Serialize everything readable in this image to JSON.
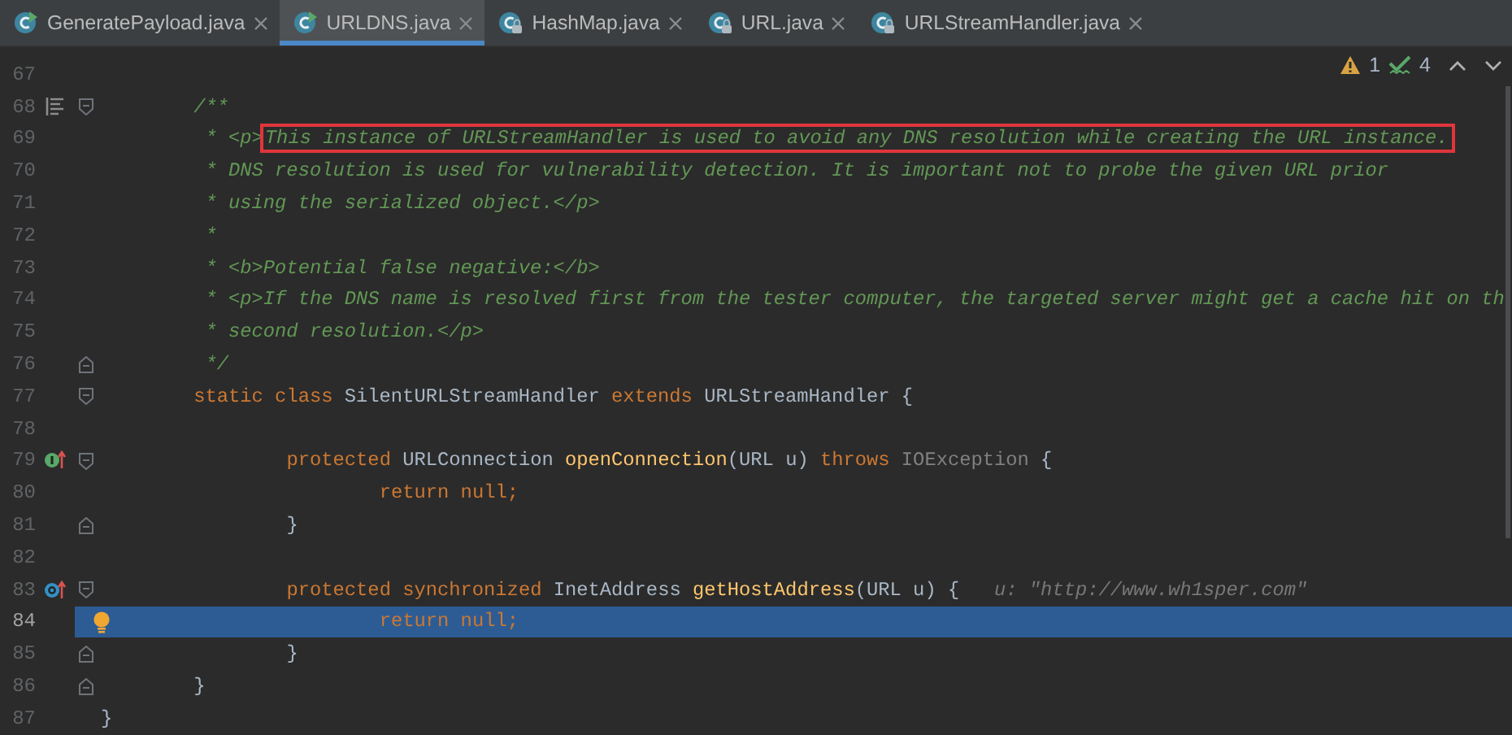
{
  "tabs": [
    {
      "label": "GeneratePayload.java",
      "kind": "source",
      "selected": false
    },
    {
      "label": "URLDNS.java",
      "kind": "source",
      "selected": true
    },
    {
      "label": "HashMap.java",
      "kind": "library",
      "selected": false
    },
    {
      "label": "URL.java",
      "kind": "library",
      "selected": false
    },
    {
      "label": "URLStreamHandler.java",
      "kind": "library",
      "selected": false
    }
  ],
  "inspections": {
    "warnings": "1",
    "typos": "4"
  },
  "lines": [
    {
      "number": "67",
      "selected": false,
      "fold_start": false,
      "fold_end": false
    },
    {
      "children": [
        {
          "number": "68",
          "kind": "javadoc",
          "selected": false,
          "fold_start": true,
          "fold_end": false,
          "tokens": [
            {
              "text": "/**",
              "kind": "comment"
            }
          ]
        },
        {
          "number": "69",
          "selected": false,
          "fold_start": false,
          "fold_end": false,
          "tokens": [
            {
              "text": "* <p>",
              "kind": "doc"
            },
            {
              "text": "This instance of URLStreamHandler is used to avoid any DNS resolution while creating the URL instance.",
              "kind": "boxed"
            }
          ]
        },
        {
          "number": "70",
          "selected": false,
          "fold_start": false,
          "fold_end": false,
          "tokens": [
            {
              "text": "* DNS resolution is used for vulnerability detection. It is important not to probe the given URL prior",
              "kind": "doc"
            }
          ]
        },
        {
          "number": "71",
          "selected": false,
          "fold_start": false,
          "fold_end": false,
          "tokens": [
            {
              "text": "* using the serialized object.</p>",
              "kind": "doc"
            }
          ]
        },
        {
          "number": "72",
          "selected": false,
          "fold_start": false,
          "fold_end": false,
          "tokens": [
            {
              "text": "*",
              "kind": "doc"
            }
          ]
        },
        {
          "number": "73",
          "selected": false,
          "fold_start": false,
          "fold_end": false,
          "tokens": [
            {
              "text": "* <b>Potential false negative:</b>",
              "kind": "doc"
            }
          ]
        },
        {
          "number": "74",
          "selected": false,
          "fold_start": false,
          "fold_end": false,
          "tokens": [
            {
              "text": "* <p>If the DNS name is resolved first from the tester computer, the targeted server might get a cache hit on th",
              "kind": "doc"
            }
          ]
        },
        {
          "number": "75",
          "selected": false,
          "fold_start": false,
          "fold_end": false,
          "tokens": [
            {
              "text": "* second resolution.</p>",
              "kind": "doc"
            }
          ]
        },
        {
          "number": "76",
          "selected": false,
          "fold_start": false,
          "fold_end": true,
          "tokens": [
            {
              "text": "*/",
              "kind": "doc"
            }
          ]
        },
        {
          "number": "77",
          "selected": false,
          "fold_start": true,
          "fold_end": false,
          "tokens": [
            {
              "text": "static class",
              "kind": "keyword"
            },
            {
              "text": "SilentURLStreamHandler",
              "kind": "plain"
            },
            {
              "text": "extends",
              "kind": "keyword"
            },
            {
              "text": "URLStreamHandler {",
              "kind": "plain"
            }
          ]
        },
        {
          "number": "78",
          "selected": false,
          "fold_start": false,
          "fold_end": false
        },
        {
          "children": [
            {
              "number": "79",
              "kind": "implements",
              "selected": false,
              "fold_start": true,
              "fold_end": false,
              "tokens": [
                {
                  "text": "protected",
                  "kind": "keyword"
                },
                {
                  "text": "URLConnection",
                  "kind": "plain"
                },
                {
                  "text": "openConnection",
                  "kind": "method"
                },
                {
                  "text": "(URL u)",
                  "kind": "glued"
                },
                {
                  "text": "throws",
                  "kind": "keyword"
                },
                {
                  "text": "IOException",
                  "kind": "muted"
                },
                {
                  "text": "{",
                  "kind": "plain"
                }
              ]
            },
            {
              "children": [
                {
                  "number": "80",
                  "selected": false,
                  "fold_start": false,
                  "fold_end": false,
                  "tokens": [
                    {
                      "text": "return null;",
                      "kind": "keyword"
                    }
                  ]
                }
              ]
            },
            {
              "number": "81",
              "selected": false,
              "fold_start": false,
              "fold_end": true,
              "tokens": [
                {
                  "text": "}",
                  "kind": "plain"
                }
              ]
            },
            {
              "number": "82",
              "selected": false,
              "fold_start": false,
              "fold_end": false
            },
            {
              "number": "83",
              "kind": "overrides",
              "selected": false,
              "fold_start": true,
              "fold_end": false,
              "tokens": [
                {
                  "text": "protected synchronized",
                  "kind": "keyword"
                },
                {
                  "text": "InetAddress",
                  "kind": "plain"
                },
                {
                  "text": "getHostAddress",
                  "kind": "method"
                },
                {
                  "text": "(URL u) {",
                  "kind": "glued"
                },
                {
                  "text": "u: \"http://www.wh1sper.com\"",
                  "kind": "hint"
                }
              ]
            },
            {
              "children": [
                {
                  "number": "84",
                  "kind": "intention",
                  "selected": true,
                  "fold_start": false,
                  "fold_end": false,
                  "tokens": [
                    {
                      "text": "return null;",
                      "kind": "keyword"
                    }
                  ]
                }
              ]
            },
            {
              "number": "85",
              "selected": false,
              "fold_start": false,
              "fold_end": true,
              "tokens": [
                {
                  "text": "}",
                  "kind": "plain"
                }
              ]
            }
          ]
        },
        {
          "number": "86",
          "selected": false,
          "fold_start": false,
          "fold_end": true,
          "tokens": [
            {
              "text": "}",
              "kind": "plain"
            }
          ]
        }
      ]
    },
    {
      "number": "87",
      "selected": false,
      "fold_start": false,
      "fold_end": false,
      "tokens": [
        {
          "text": "}",
          "kind": "plain"
        }
      ]
    }
  ]
}
